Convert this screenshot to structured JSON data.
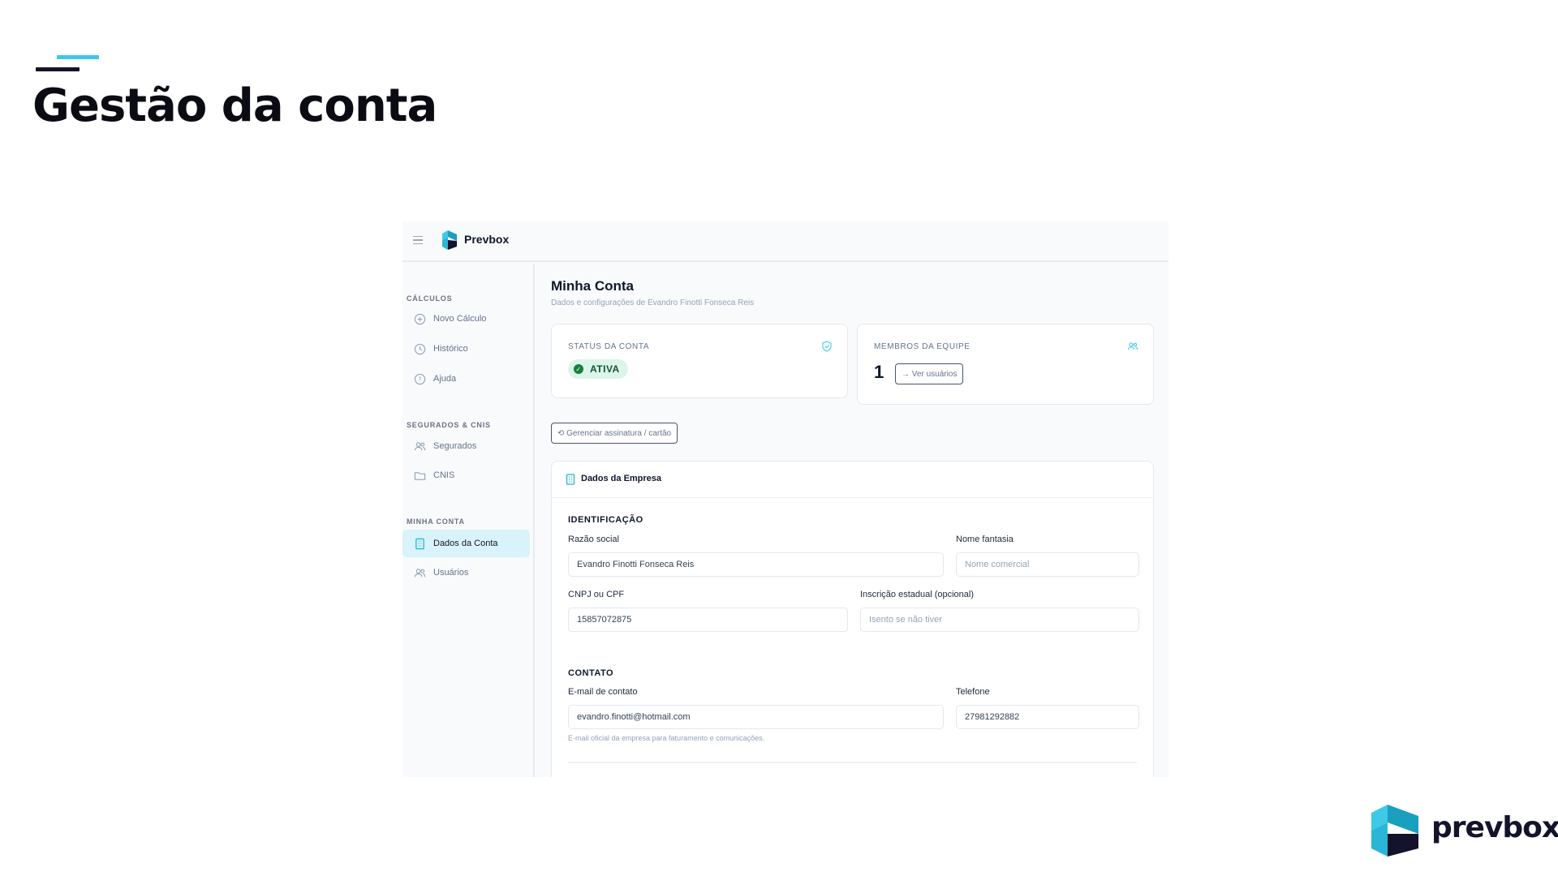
{
  "slide": {
    "title": "Gestão da conta",
    "accent_color": "#3ec9e6",
    "dark_color": "#13132b",
    "brand_name": "prevbox"
  },
  "app": {
    "name": "Prevbox",
    "sidebar": {
      "sections": [
        {
          "title": "CÁLCULOS",
          "items": [
            {
              "label": "Novo Cálculo",
              "icon": "plus-circle-icon"
            },
            {
              "label": "Histórico",
              "icon": "clock-icon"
            },
            {
              "label": "Ajuda",
              "icon": "help-circle-icon"
            }
          ]
        },
        {
          "title": "SEGURADOS & CNIS",
          "items": [
            {
              "label": "Segurados",
              "icon": "users-icon"
            },
            {
              "label": "CNIS",
              "icon": "folder-icon"
            }
          ]
        },
        {
          "title": "MINHA CONTA",
          "items": [
            {
              "label": "Dados da Conta",
              "icon": "building-icon",
              "active": true
            },
            {
              "label": "Usuários",
              "icon": "users-icon"
            }
          ]
        }
      ]
    },
    "main": {
      "title": "Minha Conta",
      "subtitle": "Dados e configurações de Evandro Finotti Fonseca Reis",
      "status_card": {
        "label": "STATUS DA CONTA",
        "status": "ATIVA",
        "icon": "shield-check-icon"
      },
      "team_card": {
        "label": "MEMBROS DA EQUIPE",
        "count": "1",
        "button": "→ Ver usuários",
        "icon": "users-icon"
      },
      "manage_button": "⟲ Gerenciar assinatura / cartão",
      "company": {
        "title": "Dados da Empresa",
        "identification_heading": "IDENTIFICAÇÃO",
        "razao_social": {
          "label": "Razão social",
          "value": "Evandro Finotti Fonseca Reis"
        },
        "nome_fantasia": {
          "label": "Nome fantasia",
          "placeholder": "Nome comercial"
        },
        "cnpj": {
          "label": "CNPJ ou CPF",
          "value": "15857072875"
        },
        "inscricao": {
          "label": "Inscrição estadual (opcional)",
          "placeholder": "Isento se não tiver"
        },
        "contact_heading": "CONTATO",
        "email": {
          "label": "E-mail de contato",
          "value": "evandro.finotti@hotmail.com",
          "help": "E-mail oficial da empresa para faturamento e comunicações."
        },
        "telefone": {
          "label": "Telefone",
          "value": "27981292882"
        }
      }
    }
  }
}
